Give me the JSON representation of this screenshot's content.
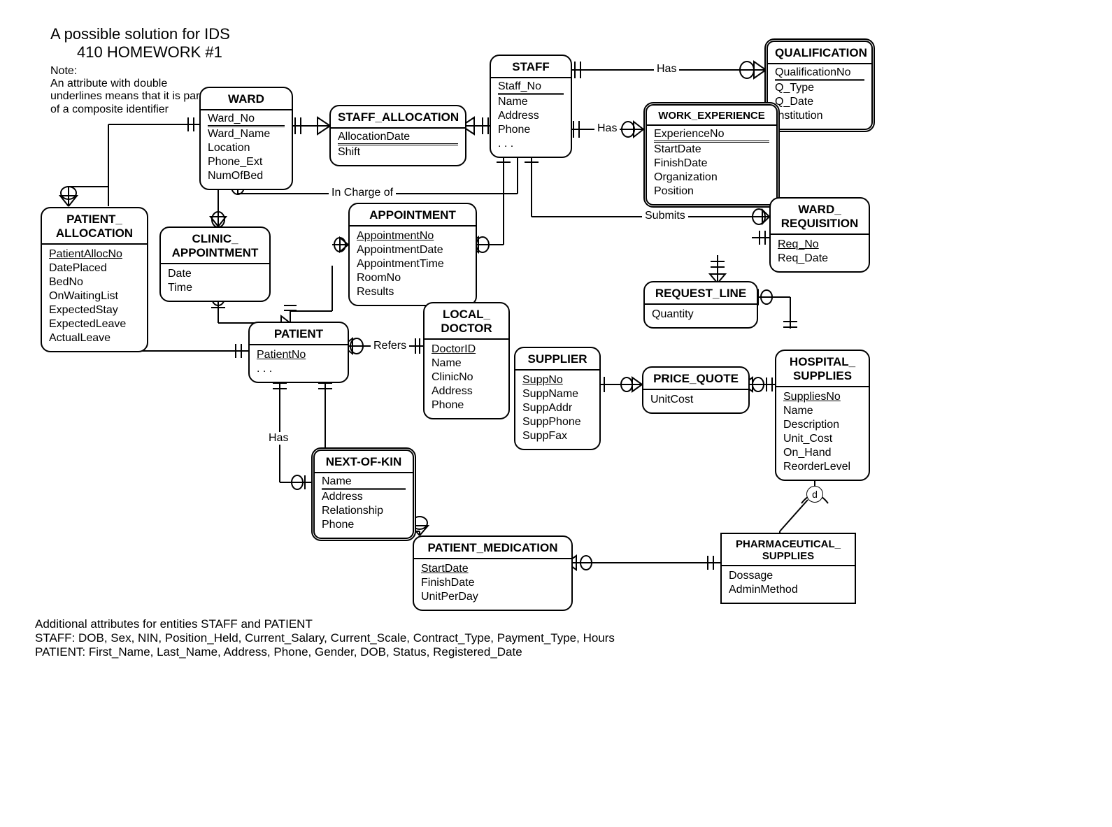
{
  "heading": {
    "line1": "A possible solution for IDS",
    "line2": "410 HOMEWORK #1"
  },
  "note": {
    "l1": "Note:",
    "l2": "An attribute with double",
    "l3": "underlines  means that it is part",
    "l4": "of a composite identifier"
  },
  "disjoint_label": "d",
  "relationships": {
    "has_qualification": "Has",
    "has_experience": "Has",
    "in_charge_of": "In Charge of",
    "submits": "Submits",
    "refers": "Refers",
    "has_kin": "Has"
  },
  "entities": {
    "ward": {
      "name": "WARD",
      "attrs": [
        "Ward_No",
        "Ward_Name",
        "Location",
        "Phone_Ext",
        "NumOfBed"
      ],
      "pk_double": [
        "Ward_No"
      ]
    },
    "staff": {
      "name": "STAFF",
      "attrs": [
        "Staff_No",
        "Name",
        "Address",
        "Phone",
        ". . ."
      ],
      "pk_double": [
        "Staff_No"
      ]
    },
    "qualification": {
      "name": "QUALIFICATION",
      "attrs": [
        "QualificationNo",
        "Q_Type",
        "Q_Date",
        "Institution"
      ],
      "pk_double": [
        "QualificationNo"
      ]
    },
    "work_experience": {
      "name": "WORK_EXPERIENCE",
      "attrs": [
        "ExperienceNo",
        "StartDate",
        "FinishDate",
        "Organization",
        "Position"
      ],
      "pk_double": [
        "ExperienceNo"
      ]
    },
    "staff_allocation": {
      "name": "STAFF_ALLOCATION",
      "attrs": [
        "AllocationDate",
        "Shift"
      ],
      "pk_double": [
        "AllocationDate"
      ]
    },
    "appointment": {
      "name": "APPOINTMENT",
      "attrs": [
        "AppointmentNo",
        "AppointmentDate",
        "AppointmentTime",
        "RoomNo",
        "Results"
      ],
      "pk": [
        "AppointmentNo"
      ]
    },
    "patient_allocation": {
      "name_l1": "PATIENT_",
      "name_l2": "ALLOCATION",
      "attrs": [
        "PatientAllocNo",
        "DatePlaced",
        "BedNo",
        "OnWaitingList",
        "ExpectedStay",
        "ExpectedLeave",
        "ActualLeave"
      ],
      "pk": [
        "PatientAllocNo"
      ]
    },
    "clinic_appointment": {
      "name_l1": "CLINIC_",
      "name_l2": "APPOINTMENT",
      "attrs": [
        "Date",
        "Time"
      ]
    },
    "ward_requisition": {
      "name_l1": "WARD_",
      "name_l2": "REQUISITION",
      "attrs": [
        "Req_No",
        "Req_Date"
      ],
      "pk": [
        "Req_No"
      ]
    },
    "request_line": {
      "name": "REQUEST_LINE",
      "attrs": [
        "Quantity"
      ]
    },
    "patient": {
      "name": "PATIENT",
      "attrs": [
        "PatientNo",
        ". . ."
      ],
      "pk": [
        "PatientNo"
      ]
    },
    "local_doctor": {
      "name_l1": "LOCAL_",
      "name_l2": "DOCTOR",
      "attrs": [
        "DoctorID",
        "Name",
        "ClinicNo",
        "Address",
        "Phone"
      ],
      "pk": [
        "DoctorID"
      ]
    },
    "supplier": {
      "name": "SUPPLIER",
      "attrs": [
        "SuppNo",
        "SuppName",
        "SuppAddr",
        "SuppPhone",
        "SuppFax"
      ],
      "pk": [
        "SuppNo"
      ]
    },
    "price_quote": {
      "name": "PRICE_QUOTE",
      "attrs": [
        "UnitCost"
      ]
    },
    "hospital_supplies": {
      "name_l1": "HOSPITAL_",
      "name_l2": "SUPPLIES",
      "attrs": [
        "SuppliesNo",
        "Name",
        "Description",
        "Unit_Cost",
        "On_Hand",
        "ReorderLevel"
      ],
      "pk": [
        "SuppliesNo"
      ]
    },
    "next_of_kin": {
      "name": "NEXT-OF-KIN",
      "attrs": [
        "Name",
        "Address",
        "Relationship",
        "Phone"
      ],
      "pk_double": [
        "Name"
      ]
    },
    "patient_medication": {
      "name": "PATIENT_MEDICATION",
      "attrs": [
        "StartDate",
        "FinishDate",
        "UnitPerDay"
      ],
      "pk": [
        "StartDate"
      ]
    },
    "pharmaceutical_supplies": {
      "name_l1": "PHARMACEUTICAL_",
      "name_l2": "SUPPLIES",
      "attrs": [
        "Dossage",
        "AdminMethod"
      ]
    }
  },
  "footnote": {
    "l1": "Additional attributes for entities STAFF and PATIENT",
    "l2": "STAFF: DOB, Sex, NIN, Position_Held, Current_Salary, Current_Scale, Contract_Type, Payment_Type, Hours",
    "l3": "PATIENT: First_Name, Last_Name, Address, Phone, Gender, DOB, Status, Registered_Date"
  }
}
